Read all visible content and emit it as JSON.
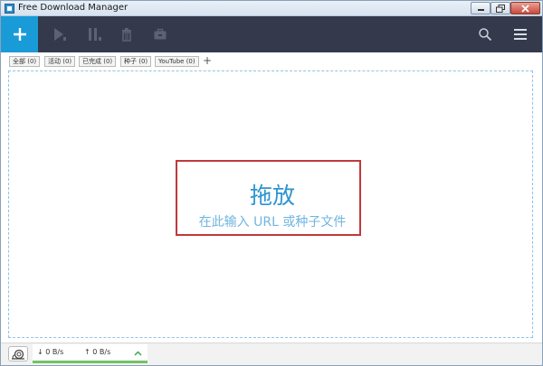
{
  "window": {
    "title": "Free Download Manager"
  },
  "toolbar": {
    "add_icon": "plus-icon",
    "resume_icon": "play-icon",
    "pause_icon": "pause-icon",
    "delete_icon": "trash-icon",
    "move_icon": "briefcase-icon",
    "search_icon": "search-icon",
    "menu_icon": "hamburger-menu-icon"
  },
  "tabs": [
    {
      "label": "全部 (0)"
    },
    {
      "label": "活动 (0)"
    },
    {
      "label": "已完成 (0)"
    },
    {
      "label": "种子 (0)"
    },
    {
      "label": "YouTube (0)"
    }
  ],
  "tabs_add_label": "+",
  "drop_area": {
    "title": "拖放",
    "hint": "在此输入 URL 或种子文件"
  },
  "status": {
    "download_speed": "↓ 0 B/s",
    "upload_speed": "↑ 0 B/s",
    "snail_icon": "snail-icon",
    "expand_icon": "chevron-up-icon"
  },
  "colors": {
    "accent": "#199bd8",
    "toolbar": "#343a4b",
    "highlight": "#c0393b",
    "status_green": "#72c462"
  }
}
